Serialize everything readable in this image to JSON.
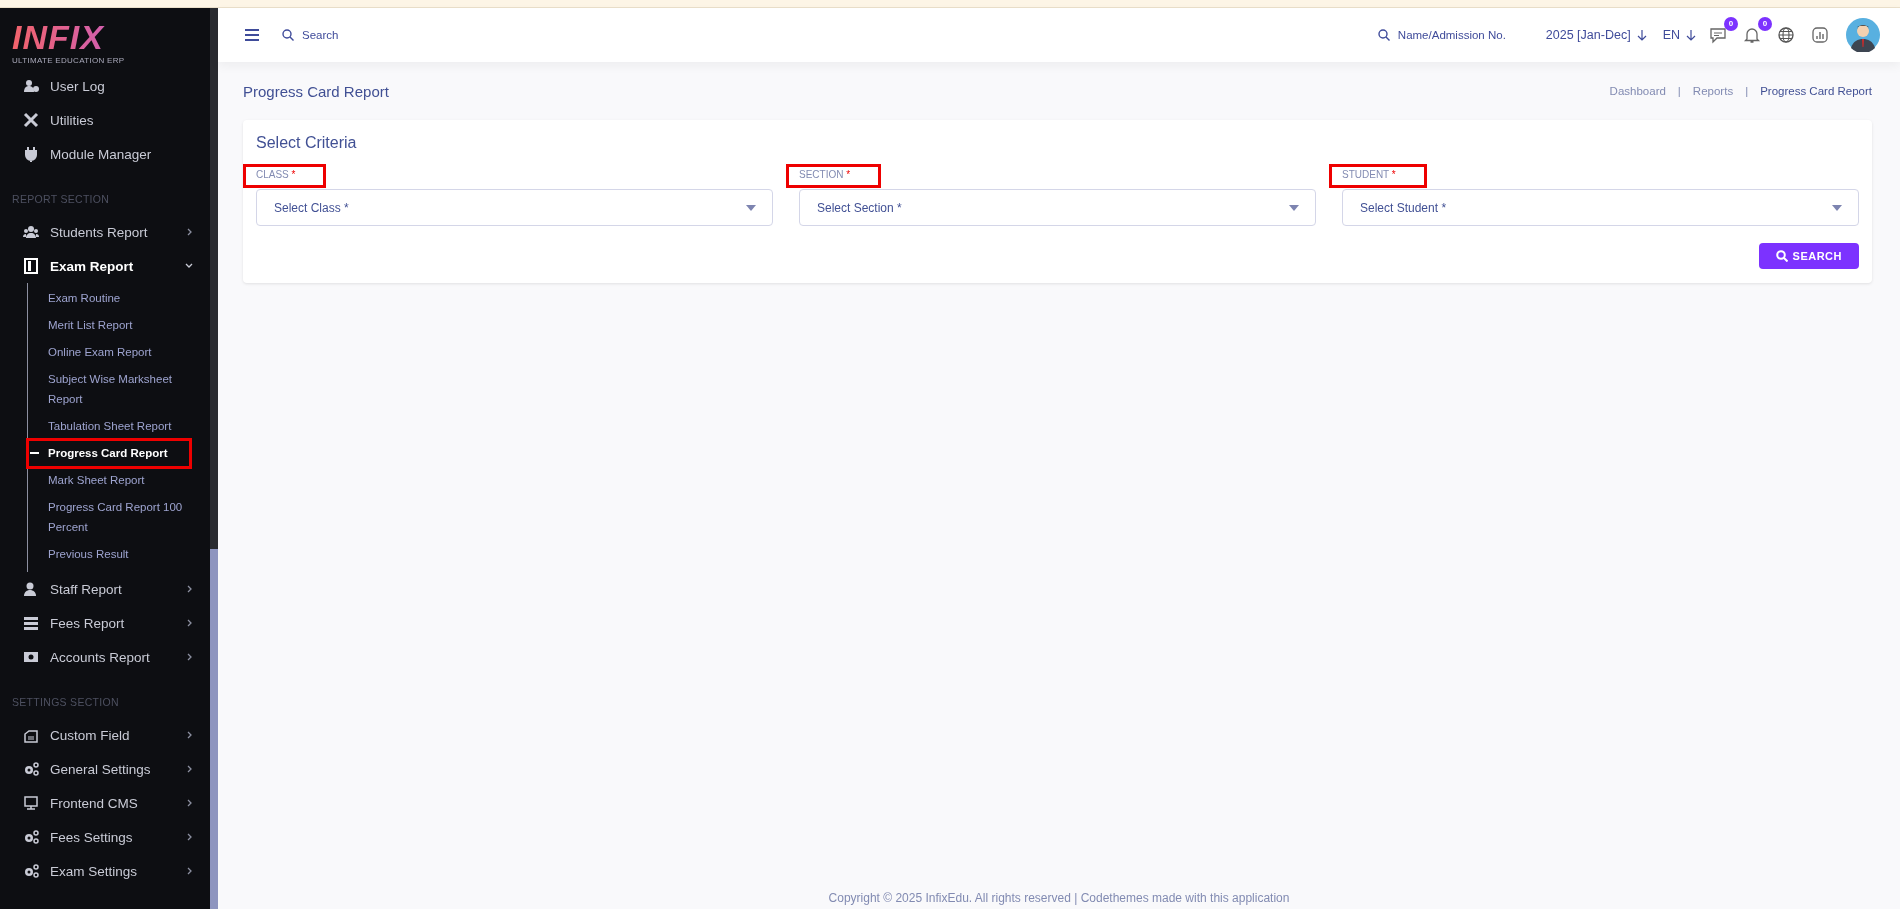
{
  "logo": {
    "name": "INFIX",
    "tagline": "ULTIMATE EDUCATION ERP"
  },
  "sidebar": {
    "items": [
      {
        "kind": "item",
        "label": "User Log",
        "expanded": false
      },
      {
        "kind": "item",
        "label": "Utilities",
        "expanded": false
      },
      {
        "kind": "item",
        "label": "Module Manager",
        "expanded": false
      },
      {
        "kind": "section",
        "label": "REPORT SECTION"
      },
      {
        "kind": "group",
        "label": "Students Report",
        "expanded": false
      },
      {
        "kind": "group",
        "label": "Exam Report",
        "expanded": true,
        "children": [
          {
            "label": "Exam Routine",
            "selected": false
          },
          {
            "label": "Merit List Report",
            "selected": false
          },
          {
            "label": "Online Exam Report",
            "selected": false
          },
          {
            "label": "Subject Wise Marksheet Report",
            "selected": false
          },
          {
            "label": "Tabulation Sheet Report",
            "selected": false
          },
          {
            "label": "Progress Card Report",
            "selected": true,
            "highlighted": true
          },
          {
            "label": "Mark Sheet Report",
            "selected": false
          },
          {
            "label": "Progress Card Report 100 Percent",
            "selected": false
          },
          {
            "label": "Previous Result",
            "selected": false
          }
        ]
      },
      {
        "kind": "group",
        "label": "Staff Report",
        "expanded": false
      },
      {
        "kind": "group",
        "label": "Fees Report",
        "expanded": false
      },
      {
        "kind": "group",
        "label": "Accounts Report",
        "expanded": false
      },
      {
        "kind": "section",
        "label": "SETTINGS SECTION"
      },
      {
        "kind": "group",
        "label": "Custom Field",
        "expanded": false
      },
      {
        "kind": "group",
        "label": "General Settings",
        "expanded": false
      },
      {
        "kind": "group",
        "label": "Frontend CMS",
        "expanded": false
      },
      {
        "kind": "group",
        "label": "Fees Settings",
        "expanded": false
      },
      {
        "kind": "group",
        "label": "Exam Settings",
        "expanded": false
      }
    ]
  },
  "header": {
    "search": {
      "placeholder": "Search"
    },
    "student_search": {
      "placeholder": "Name/Admission No."
    },
    "session": "2025 [Jan-Dec]",
    "language": "EN",
    "message_count": "0",
    "notification_count": "0"
  },
  "page": {
    "title": "Progress Card Report",
    "separator": "|",
    "breadcrumbs": [
      {
        "label": "Dashboard",
        "selected": false
      },
      {
        "label": "Reports",
        "selected": false
      },
      {
        "label": "Progress Card Report",
        "selected": true
      }
    ]
  },
  "criteria": {
    "title": "Select Criteria",
    "fields": [
      {
        "label": "CLASS",
        "marker": "*",
        "placeholder": "Select Class *",
        "highlighted": true
      },
      {
        "label": "SECTION",
        "marker": "*",
        "placeholder": "Select Section *",
        "highlighted": true
      },
      {
        "label": "STUDENT",
        "marker": "*",
        "placeholder": "Select Student *",
        "highlighted": true
      }
    ],
    "button": "SEARCH"
  },
  "footer": "Copyright © 2025 InfixEdu. All rights reserved | Codethemes made with this application"
}
